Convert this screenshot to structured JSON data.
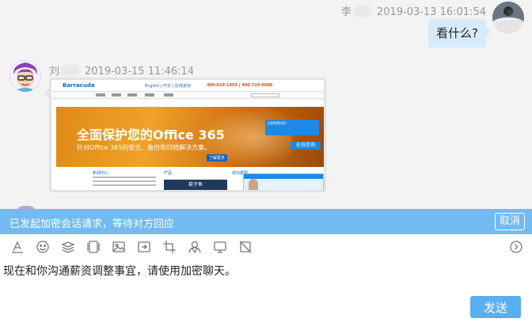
{
  "messages": [
    {
      "id": "msg-right",
      "sender": "李",
      "timestamp": "2019-03-13 16:01:54",
      "text": "看什么?"
    },
    {
      "id": "msg-left",
      "sender": "刘",
      "timestamp": "2019-03-15 11:46:14"
    }
  ],
  "shared_image": {
    "logo": "Barracuda",
    "top_links": "English | 中文 | 在线咨询",
    "hotline": "400-619-1503 | 400-720-6008",
    "banner_title": "全面保护您的Office 365",
    "banner_subtitle": "针对Office 365的安全、备份和归档解决方案。",
    "banner_cta": "了解更多",
    "promo_text": "立即免费试用",
    "online_chat": "在线咨询",
    "col1_title": "新闻中心",
    "col2_title": "产品",
    "col3_title": "成功案例",
    "dark_box": "梭子鱼"
  },
  "encryption_banner": {
    "text": "已发起加密会话请求，等待对方回应",
    "cancel_label": "取消"
  },
  "toolbar": {
    "icons": [
      "font-icon",
      "emoji-icon",
      "layers-icon",
      "file-icon",
      "image-icon",
      "forward-icon",
      "crop-icon",
      "group-icon",
      "screen-icon",
      "no-image-icon",
      "more-icon"
    ]
  },
  "composer": {
    "text": "现在和你沟通薪资调整事宜，请使用加密聊天。",
    "send_label": "发送"
  },
  "colors": {
    "banner_bg": "#73baf0",
    "send_bg": "#5aaef2",
    "bubble_bg": "#d6eaf9"
  }
}
